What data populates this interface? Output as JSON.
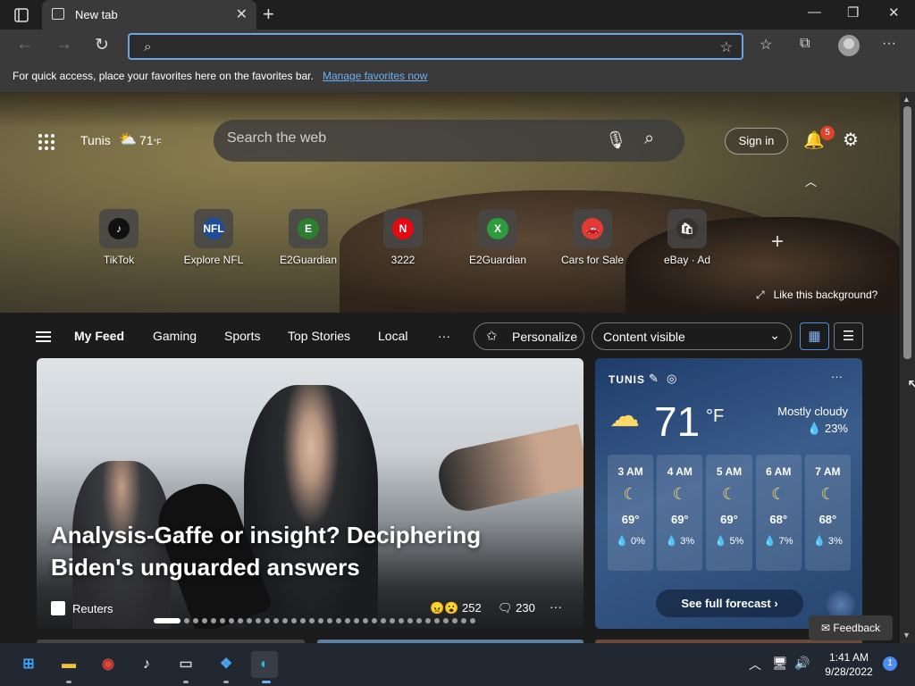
{
  "browser": {
    "tab_title": "New tab",
    "address_value": "",
    "favorites_bar_text": "For quick access, place your favorites here on the favorites bar.",
    "favorites_bar_link": "Manage favorites now"
  },
  "header": {
    "city": "Tunis",
    "temperature": "71",
    "temperature_unit": "°F",
    "search_placeholder": "Search the web",
    "sign_in_label": "Sign in",
    "notification_count": "5"
  },
  "quick_links": [
    {
      "label": "TikTok",
      "glyph": "♪",
      "color": "#111111"
    },
    {
      "label": "Explore NFL",
      "glyph": "NFL",
      "color": "#1f4c99"
    },
    {
      "label": "E2Guardian",
      "glyph": "E",
      "color": "#2e7d32"
    },
    {
      "label": "3222",
      "glyph": "N",
      "color": "#e50914"
    },
    {
      "label": "E2Guardian",
      "glyph": "X",
      "color": "#2e9b3e"
    },
    {
      "label": "Cars for Sale",
      "glyph": "🚗",
      "color": "#e53935"
    },
    {
      "label": "eBay · Ad",
      "glyph": "🛍",
      "color": "#333333"
    }
  ],
  "background_link": "Like this background?",
  "feed": {
    "tabs": [
      "My Feed",
      "Gaming",
      "Sports",
      "Top Stories",
      "Local"
    ],
    "more": "···",
    "personalize_label": "Personalize",
    "content_visibility": "Content visible"
  },
  "hero_story": {
    "headline": "Analysis-Gaffe or insight? Deciphering Biden's unguarded answers",
    "source": "Reuters",
    "reactions": "252",
    "comments": "230",
    "slide_count": 34,
    "active_slide": 0
  },
  "weather_card": {
    "city": "TUNIS",
    "temperature": "71",
    "unit": "°F",
    "condition": "Mostly cloudy",
    "precip": "23%",
    "hourly": [
      {
        "time": "3 AM",
        "temp": "69°",
        "precip": "0%"
      },
      {
        "time": "4 AM",
        "temp": "69°",
        "precip": "3%"
      },
      {
        "time": "5 AM",
        "temp": "69°",
        "precip": "5%"
      },
      {
        "time": "6 AM",
        "temp": "68°",
        "precip": "7%"
      },
      {
        "time": "7 AM",
        "temp": "68°",
        "precip": "3%"
      }
    ],
    "forecast_link": "See full forecast ›"
  },
  "feedback_label": "Feedback",
  "taskbar": {
    "time": "1:41 AM",
    "date": "9/28/2022",
    "notification_count": "1"
  }
}
